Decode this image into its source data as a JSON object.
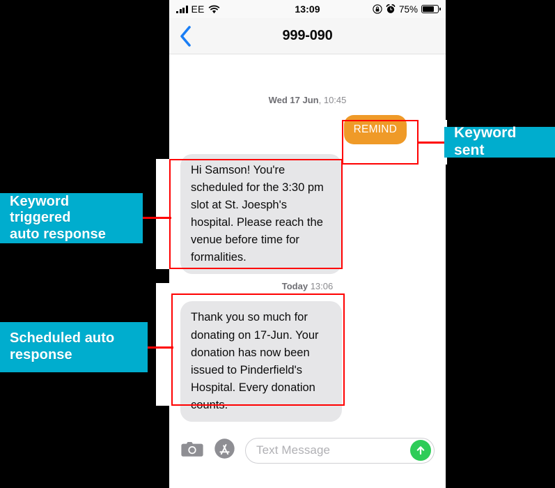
{
  "phone": {
    "status_bar": {
      "carrier": "EE",
      "time": "13:09",
      "battery_percent": "75%",
      "icons": [
        "signal-bars-icon",
        "wifi-icon",
        "rotation-lock-icon",
        "alarm-clock-icon",
        "battery-icon"
      ]
    },
    "nav_bar": {
      "back_icon": "back-chevron-icon",
      "title": "999-090"
    },
    "conversation": {
      "timestamp_1_day": "Wed 17 Jun",
      "timestamp_1_time": ", 10:45",
      "timestamp_2_day": "Today",
      "timestamp_2_time": " 13:06",
      "messages": [
        {
          "direction": "outgoing",
          "text": "REMIND"
        },
        {
          "direction": "incoming",
          "text": "Hi Samson! You're scheduled for the 3:30 pm slot at St. Joesph's hospital. Please reach the venue before time for formalities."
        },
        {
          "direction": "incoming",
          "text": "Thank you so much for donating on 17-Jun. Your donation has now been issued to Pinderfield's Hospital. Every donation counts."
        }
      ]
    },
    "toolbar": {
      "camera_icon": "camera-icon",
      "appstore_icon": "app-store-icon",
      "input_placeholder": "Text Message",
      "send_icon": "send-arrow-up-icon"
    }
  },
  "annotations": {
    "accent_color": "#00ADCE",
    "callout_color": "#FF0000",
    "labels": [
      {
        "id": "keyword-sent",
        "text": "Keyword sent"
      },
      {
        "id": "keyword-triggered",
        "text": "Keyword triggered\nauto response"
      },
      {
        "id": "scheduled",
        "text": "Scheduled auto\nresponse"
      }
    ]
  },
  "colors": {
    "outgoing_bubble": "#EF9A28",
    "incoming_bubble": "#E6E6E8",
    "send_button": "#2ECC58",
    "back_chevron": "#1A7EF5"
  }
}
